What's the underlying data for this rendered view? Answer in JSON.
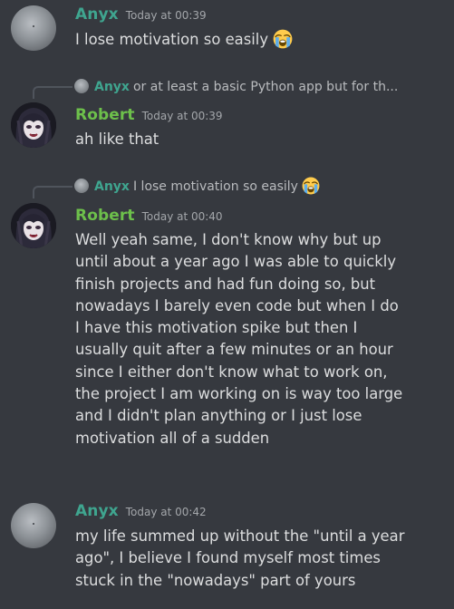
{
  "messages": [
    {
      "username": "Anyx",
      "timestamp": "Today at 00:39",
      "lines": [
        "I lose motivation so easily"
      ],
      "emoji": "loudly-crying-face"
    },
    {
      "reply": {
        "username": "Anyx",
        "text": "or at least a basic Python app but for th..."
      },
      "username": "Robert",
      "timestamp": "Today at 00:39",
      "lines": [
        "ah like that"
      ]
    },
    {
      "reply": {
        "username": "Anyx",
        "text": "I lose motivation so easily",
        "emoji": "loudly-crying-face"
      },
      "username": "Robert",
      "timestamp": "Today at 00:40",
      "lines": [
        "Well yeah same, I don't know why but up",
        "until about a year ago I was able to quickly",
        "finish projects and had fun doing so, but",
        "nowadays I barely even code but when I do",
        "I have this motivation spike but then I",
        "usually quit after a few minutes or an hour",
        "since I either don't know what to work on,",
        "the project I am working on is way too large",
        "and I didn't plan anything or I just lose",
        "motivation all of a sudden"
      ]
    },
    {
      "username": "Anyx",
      "timestamp": "Today at 00:42",
      "lines": [
        "my life summed up without the \"until a year",
        "ago\", I believe I found myself most times",
        "stuck in the \"nowadays\" part of yours"
      ]
    }
  ],
  "colors": {
    "background": "#36393f",
    "anyx": "#3fa58f",
    "robert": "#6dc04b",
    "text": "#dcddde",
    "muted": "#a3a6aa"
  }
}
